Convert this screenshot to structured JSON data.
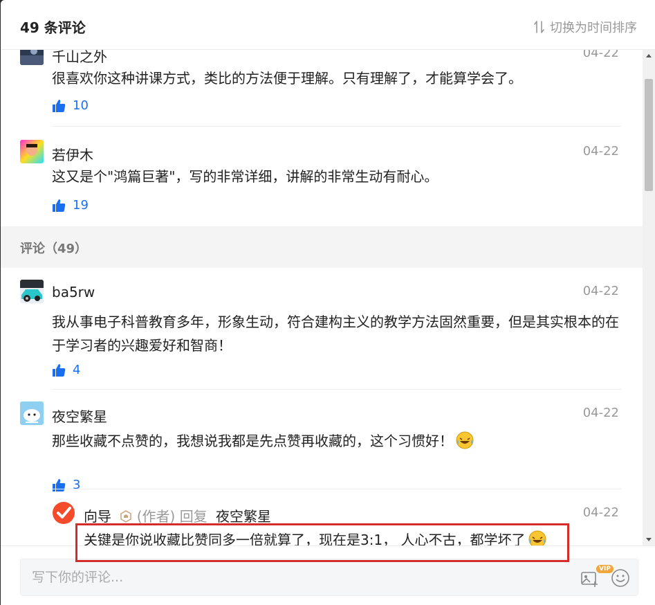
{
  "header": {
    "title": "49 条评论",
    "sort_label": "切换为时间排序"
  },
  "comments_top": [
    {
      "name": "千山之外",
      "date": "04-22",
      "text": "很喜欢你这种讲课方式，类比的方法便于理解。只有理解了，才能算学会了。",
      "likes": "10"
    },
    {
      "name": "若伊木",
      "date": "04-22",
      "text": "这又是个\"鸿篇巨著\"，写的非常详细，讲解的非常生动有耐心。",
      "likes": "19"
    }
  ],
  "section": {
    "title": "评论（49）"
  },
  "comments": [
    {
      "name": "ba5rw",
      "date": "04-22",
      "text": "我从事电子科普教育多年，形象生动，符合建构主义的教学方法固然重要，但是其实根本的在于学习者的兴趣爱好和智商！",
      "likes": "4"
    },
    {
      "name": "夜空繁星",
      "date": "04-22",
      "text": "那些收藏不点赞的，我想说我都是先点赞再收藏的，这个习惯好！",
      "likes": "3",
      "emoji": "laughing-tears-emoji"
    }
  ],
  "reply": {
    "name": "向导",
    "author_tag": "(作者)",
    "reply_word": "回复",
    "target": "夜空繁星",
    "date": "04-22",
    "text": "关键是你说收藏比赞同多一倍就算了，现在是3:1， 人心不古，都学坏了",
    "emoji": "laughing-tears-emoji"
  },
  "footer": {
    "input_placeholder": "写下你的评论...",
    "vip_label": "VIP"
  },
  "colors": {
    "link_blue": "#1a6ff0",
    "muted_gray": "#999999",
    "highlight_red": "#d42b2b"
  }
}
